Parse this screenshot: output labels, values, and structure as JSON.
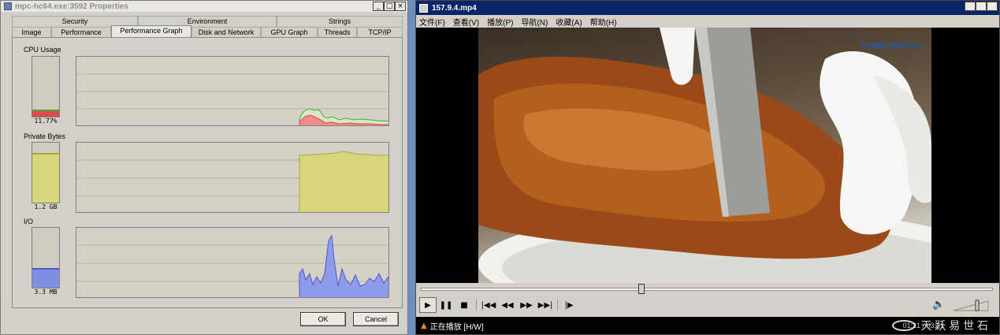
{
  "process_window": {
    "title": "mpc-hc64.exe:3592 Properties",
    "tabs_top": [
      "Security",
      "Environment",
      "Strings"
    ],
    "tabs_bottom": [
      "Image",
      "Performance",
      "Performance Graph",
      "Disk and Network",
      "GPU Graph",
      "Threads",
      "TCP/IP"
    ],
    "active_tab": "Performance Graph",
    "sections": {
      "cpu": {
        "label": "CPU Usage",
        "value_text": "11.77%",
        "meter_fraction": 0.12
      },
      "private": {
        "label": "Private Bytes",
        "value_text": "1.2 GB",
        "meter_fraction": 0.83
      },
      "io": {
        "label": "I/O",
        "value_text": "3.3  MB",
        "meter_fraction": 0.33
      }
    },
    "buttons": {
      "ok": "OK",
      "cancel": "Cancel"
    },
    "colors": {
      "cpu_kernel": "#e04a4a",
      "cpu_user": "#3fae3f",
      "private_bytes": "#d8d67a",
      "io": "#7f8fe3"
    }
  },
  "player_window": {
    "title": "157.9.4.mp4",
    "menu": [
      "文件(F)",
      "查看(V)",
      "播放(P)",
      "导航(N)",
      "收藏(A)",
      "帮助(H)"
    ],
    "video_logo": "CHIMEI INNOLUX",
    "seek_fraction": 0.385,
    "status_text": "正在播放 [H/W]",
    "status_time": "01:21 / 03:31",
    "site_watermark": "天  跃  易  世  石",
    "volume_fraction": 0.7,
    "controls": {
      "play": "▶",
      "pause": "❚❚",
      "stop": "■",
      "prev": "|◀◀",
      "rewind": "◀◀",
      "forward": "▶▶",
      "next": "▶▶|",
      "frame_step": "|▶",
      "volume": "🔈"
    }
  },
  "window_buttons": {
    "minimize": "_",
    "maximize": "□",
    "close": "×"
  }
}
